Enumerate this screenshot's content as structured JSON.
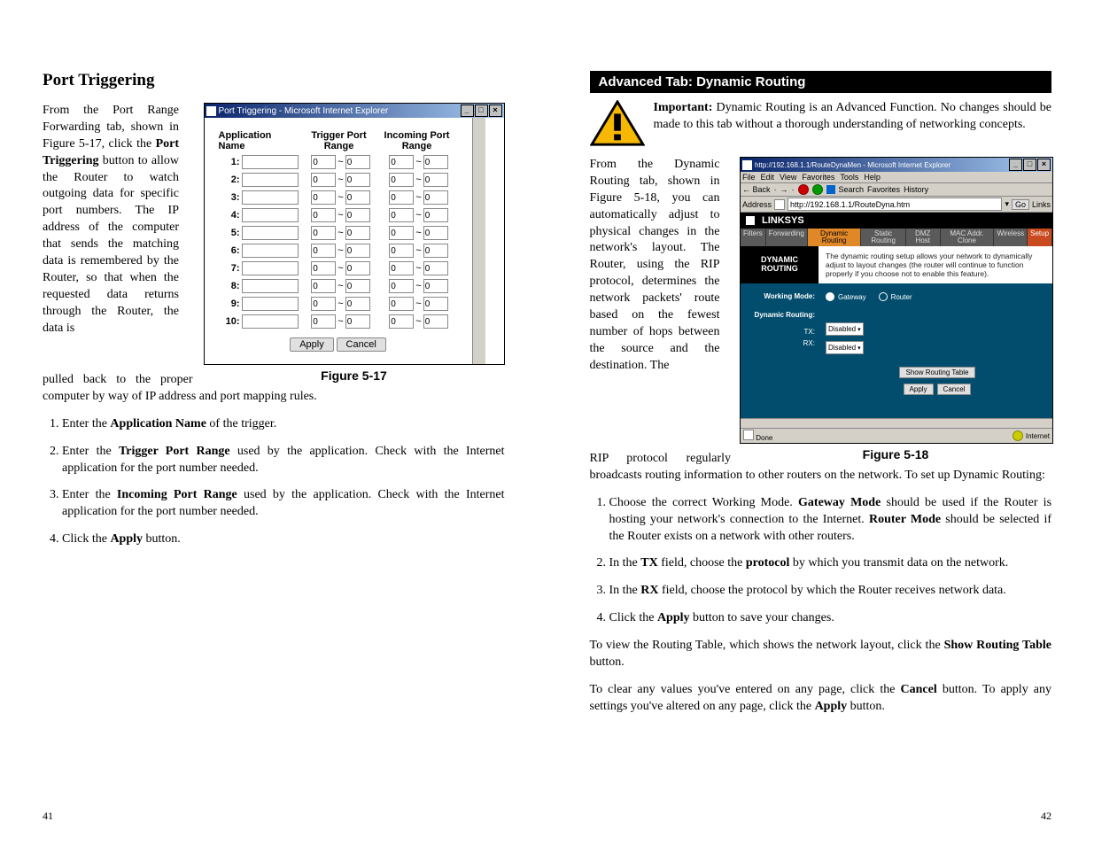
{
  "left": {
    "heading": "Port Triggering",
    "intro_part1": "From the Port Range Forwarding tab, shown in Figure 5-17, click the ",
    "bold1": "Port Triggering",
    "intro_part2": " button to allow the Router to watch outgoing data for specific port numbers. The IP address of the computer that sends the matching data is remembered by the Router, so that when the requested data returns through the Router, the data is",
    "intro_part3": "pulled back to the proper computer by way of IP address and port mapping rules.",
    "list": [
      {
        "pre": "Enter the ",
        "b": "Application Name",
        "post": " of the trigger."
      },
      {
        "pre": "Enter the ",
        "b": "Trigger Port Range",
        "post": " used by the application. Check with the Internet application for the port number needed."
      },
      {
        "pre": "Enter the ",
        "b": "Incoming Port Range",
        "post": " used by the application. Check with the Internet application for the port number needed."
      },
      {
        "pre": "Click the ",
        "b": "Apply",
        "post": " button."
      }
    ],
    "page_num": "41",
    "figure": {
      "title": "Port Triggering - Microsoft Internet Explorer",
      "hdr_name": "Application Name",
      "hdr_trig": "Trigger Port Range",
      "hdr_inc": "Incoming Port Range",
      "rows": [
        "1:",
        "2:",
        "3:",
        "4:",
        "5:",
        "6:",
        "7:",
        "8:",
        "9:",
        "10:"
      ],
      "port_default": "0",
      "btn_apply": "Apply",
      "btn_cancel": "Cancel",
      "caption": "Figure 5-17"
    }
  },
  "right": {
    "section": "Advanced Tab: Dynamic Routing",
    "warn_b": "Important:",
    "warn_rest": " Dynamic Routing is an Advanced Function. No changes should be made to this tab without a thorough understanding of networking concepts.",
    "intro_narrow": "From the Dynamic Routing tab, shown in Figure 5-18, you can automatically adjust to physical changes in the network's layout. The Router, using the RIP protocol, determines the network packets' route based on the fewest number of hops between the source and the destination. The",
    "intro_rest": "RIP protocol regularly broadcasts routing information to other routers on the network. To set up Dynamic Routing:",
    "list": [
      {
        "seq": "Choose the correct Working Mode. ",
        "b1": "Gateway Mode",
        "mid": " should be used if the Router is hosting your network's connection to the Internet. ",
        "b2": "Router Mode",
        "end": " should be selected if the Router exists on a network with other routers."
      },
      {
        "seq": "In the ",
        "b1": "TX",
        "mid": " field, choose the ",
        "b2": "protocol",
        "end": " by which you transmit data on the network."
      },
      {
        "seq": "In the ",
        "b1": "RX",
        "mid": " field, choose the protocol by which the Router receives network data.",
        "b2": "",
        "end": ""
      },
      {
        "seq": "Click the ",
        "b1": "Apply",
        "mid": " button to save your changes.",
        "b2": "",
        "end": ""
      }
    ],
    "tail1_a": "To view the Routing Table, which shows the network layout, click the ",
    "tail1_b": "Show Routing Table",
    "tail1_c": " button.",
    "tail2_a": "To clear any values you've entered on any page, click  the ",
    "tail2_b": "Cancel",
    "tail2_c": " button.  To apply any settings you've altered on any page, click the ",
    "tail2_d": "Apply",
    "tail2_e": " button.",
    "page_num": "42",
    "figure": {
      "title": "http://192.168.1.1/RouteDynaMen - Microsoft Internet Explorer",
      "menu": [
        "File",
        "Edit",
        "View",
        "Favorites",
        "Tools",
        "Help"
      ],
      "back": "← Back",
      "search": "Search",
      "fav": "Favorites",
      "hist": "History",
      "addr_lbl": "Address",
      "addr": "http://192.168.1.1/RouteDyna.htm",
      "go": "Go",
      "links": "Links",
      "brand": "LINKSYS",
      "tabs": [
        "Filters",
        "Forwarding",
        "Dynamic Routing",
        "Static Routing",
        "DMZ Host",
        "MAC Addr. Clone",
        "Wireless",
        "Setup"
      ],
      "dr_title": "DYNAMIC ROUTING",
      "dr_desc": "The dynamic routing setup allows your network to dynamically adjust to layout changes (the router will continue to function properly if you choose not to enable this feature).",
      "wm_lbl": "Working Mode:",
      "wm_g": "Gateway",
      "wm_r": "Router",
      "dr_lbl": "Dynamic Routing:",
      "tx": "TX:",
      "rx": "RX:",
      "disabled": "Disabled",
      "show": "Show Routing Table",
      "apply": "Apply",
      "cancel": "Cancel",
      "done": "Done",
      "internet": "Internet",
      "caption": "Figure 5-18"
    }
  }
}
